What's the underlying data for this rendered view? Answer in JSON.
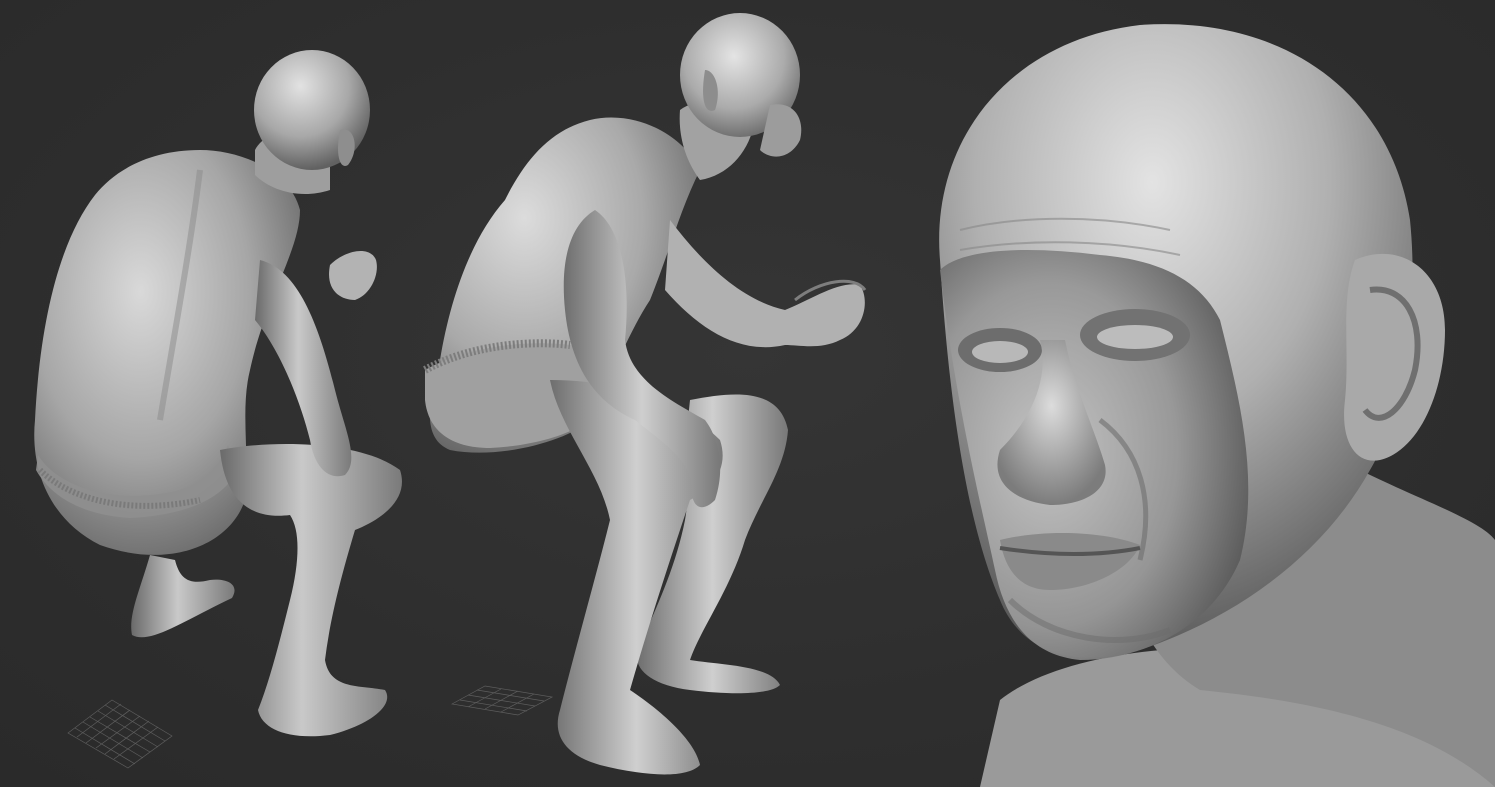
{
  "scene": {
    "background_color": "#2f2f2f",
    "clay_color": "#a9a9a9",
    "gizmo_color": "#c0202a",
    "views": [
      {
        "name": "crouching-figure-back-view"
      },
      {
        "name": "crouching-figure-side-view"
      },
      {
        "name": "head-closeup-view"
      }
    ]
  }
}
